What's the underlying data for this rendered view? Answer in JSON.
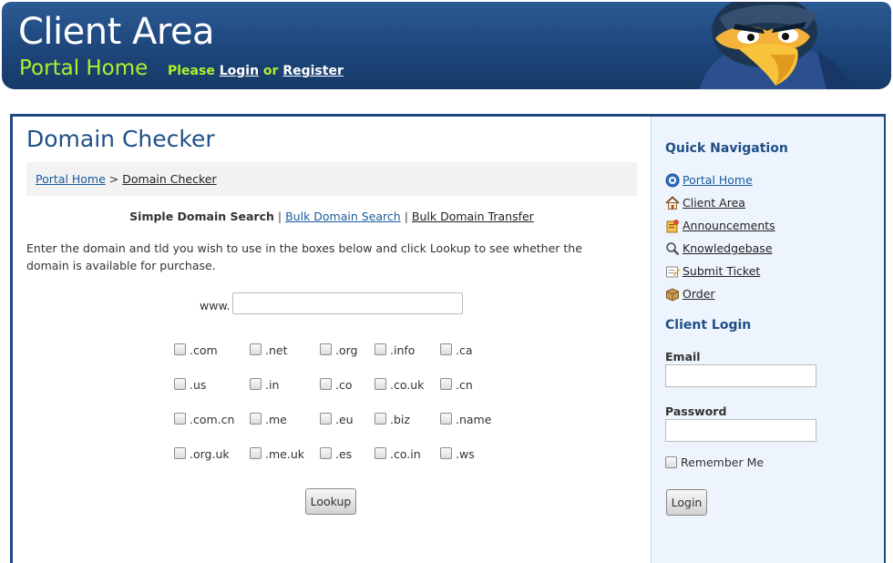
{
  "header": {
    "title": "Client Area",
    "subtitle": "Portal Home",
    "auth_prefix": "Please",
    "login_label": "Login",
    "auth_or": "or",
    "register_label": "Register"
  },
  "main": {
    "title": "Domain Checker",
    "breadcrumb": {
      "home": "Portal Home",
      "separator": ">",
      "current": "Domain Checker"
    },
    "search_modes": {
      "current": "Simple Domain Search",
      "separator": "|",
      "bulk_search": "Bulk Domain Search",
      "bulk_transfer": "Bulk Domain Transfer"
    },
    "instructions": "Enter the domain and tld you wish to use in the boxes below and click Lookup to see whether the domain is available for purchase.",
    "www_prefix": "www.",
    "domain_value": "",
    "tlds": [
      ".com",
      ".net",
      ".org",
      ".info",
      ".ca",
      ".us",
      ".in",
      ".co",
      ".co.uk",
      ".cn",
      ".com.cn",
      ".me",
      ".eu",
      ".biz",
      ".name",
      ".org.uk",
      ".me.uk",
      ".es",
      ".co.in",
      ".ws"
    ],
    "lookup_label": "Lookup"
  },
  "sidebar": {
    "quick_nav_title": "Quick Navigation",
    "nav_items": [
      {
        "label": "Portal Home",
        "icon": "globe-help-icon"
      },
      {
        "label": "Client Area",
        "icon": "house-icon"
      },
      {
        "label": "Announcements",
        "icon": "announcements-icon"
      },
      {
        "label": "Knowledgebase",
        "icon": "magnifier-icon"
      },
      {
        "label": "Submit Ticket",
        "icon": "ticket-icon"
      },
      {
        "label": "Order",
        "icon": "package-icon"
      }
    ],
    "login_title": "Client Login",
    "email_label": "Email",
    "email_value": "",
    "password_label": "Password",
    "password_value": "",
    "remember_label": "Remember Me",
    "login_button": "Login"
  },
  "colors": {
    "header_blue": "#1d467b",
    "accent_green": "#aef02c",
    "heading_blue": "#1f4f86",
    "link_blue": "#1a5a9c",
    "sidebar_bg": "#eef4fd"
  }
}
